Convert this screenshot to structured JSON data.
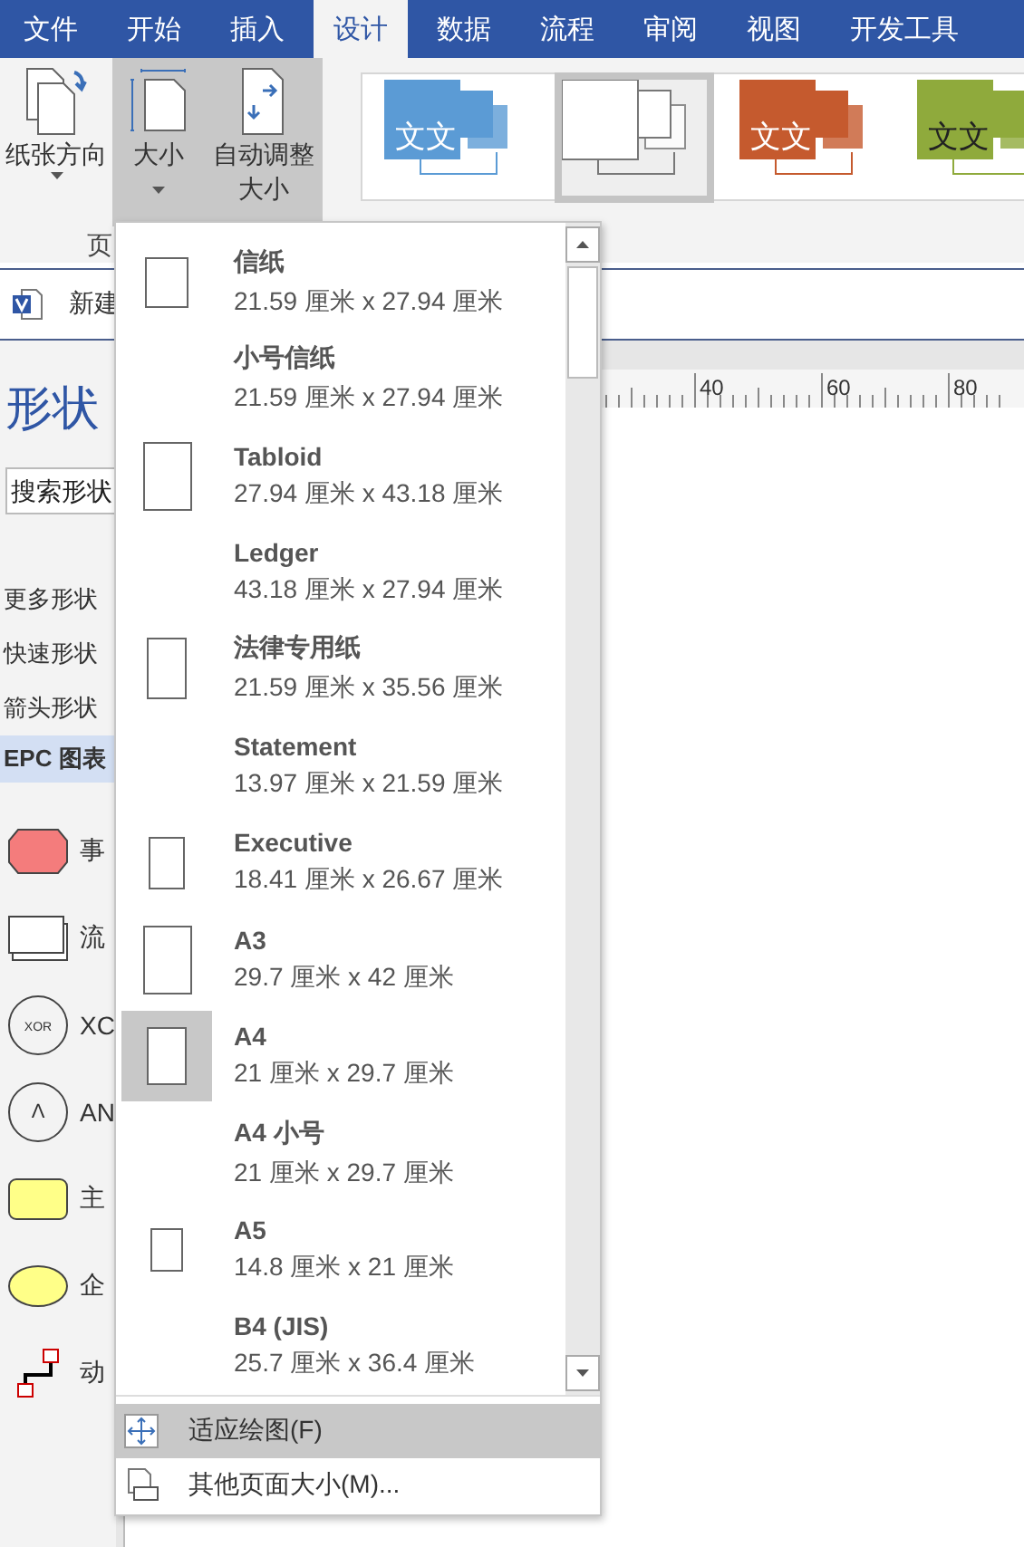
{
  "tabs": [
    {
      "label": "文件",
      "selected": false
    },
    {
      "label": "开始",
      "selected": false
    },
    {
      "label": "插入",
      "selected": false
    },
    {
      "label": "设计",
      "selected": true
    },
    {
      "label": "数据",
      "selected": false
    },
    {
      "label": "流程",
      "selected": false
    },
    {
      "label": "审阅",
      "selected": false
    },
    {
      "label": "视图",
      "selected": false
    },
    {
      "label": "开发工具",
      "selected": false
    }
  ],
  "ribbon": {
    "orientation_button": {
      "label": "纸张方向"
    },
    "size_button": {
      "label": "大小",
      "open": true
    },
    "autofit_button": {
      "label": "自动调整大小"
    },
    "group_label": "页",
    "themes": [
      {
        "text": "文文",
        "color": "#5b9bd5",
        "selected": false
      },
      {
        "color": "#ffffff",
        "selected": true
      },
      {
        "text": "文文",
        "color": "#c55a2e",
        "selected": false
      },
      {
        "text": "文文",
        "color": "#8faa3c",
        "selected": false
      }
    ]
  },
  "doc_tab": {
    "label": "新建"
  },
  "shapes_panel": {
    "title": "形状",
    "placeholder": "搜索形状",
    "links": [
      "更多形状",
      "快速形状",
      "箭头形状"
    ],
    "stencils": [
      {
        "label": "EPC 图表",
        "selected": true
      }
    ],
    "shapes": [
      {
        "kind": "event",
        "label": "事"
      },
      {
        "kind": "process",
        "label": "流"
      },
      {
        "kind": "circle",
        "symbol": "XOR",
        "label": "XC"
      },
      {
        "kind": "circle",
        "symbol": "Λ",
        "label": "AN"
      },
      {
        "kind": "rect",
        "label": "主"
      },
      {
        "kind": "ellipse",
        "label": "企"
      },
      {
        "kind": "connector",
        "label": "动"
      }
    ]
  },
  "ruler": {
    "labels": [
      "40",
      "60",
      "80"
    ]
  },
  "menu": {
    "items": [
      {
        "name": "信纸",
        "size": "21.59 厘米 x 27.94 厘米",
        "preview": true,
        "selected": false
      },
      {
        "name": "小号信纸",
        "size": "21.59 厘米 x 27.94 厘米",
        "preview": false,
        "selected": false
      },
      {
        "name": "Tabloid",
        "size": "27.94 厘米 x 43.18 厘米",
        "preview": true,
        "selected": false
      },
      {
        "name": "Ledger",
        "size": "43.18 厘米 x 27.94 厘米",
        "preview": false,
        "selected": false
      },
      {
        "name": "法律专用纸",
        "size": "21.59 厘米 x 35.56 厘米",
        "preview": true,
        "selected": false
      },
      {
        "name": "Statement",
        "size": "13.97 厘米 x 21.59 厘米",
        "preview": false,
        "selected": false
      },
      {
        "name": "Executive",
        "size": "18.41 厘米 x 26.67 厘米",
        "preview": true,
        "selected": false
      },
      {
        "name": "A3",
        "size": "29.7 厘米 x 42 厘米",
        "preview": true,
        "selected": false
      },
      {
        "name": "A4",
        "size": "21 厘米 x 29.7 厘米",
        "preview": true,
        "selected": true
      },
      {
        "name": "A4 小号",
        "size": "21 厘米 x 29.7 厘米",
        "preview": false,
        "selected": false
      },
      {
        "name": "A5",
        "size": "14.8 厘米 x 21 厘米",
        "preview": true,
        "selected": false
      },
      {
        "name": "B4 (JIS)",
        "size": "25.7 厘米 x 36.4 厘米",
        "preview": false,
        "selected": false
      }
    ],
    "commands": [
      {
        "kind": "fit",
        "label": "适应绘图(F)",
        "highlighted": true
      },
      {
        "kind": "more",
        "label": "其他页面大小(M)...",
        "highlighted": false
      }
    ]
  }
}
